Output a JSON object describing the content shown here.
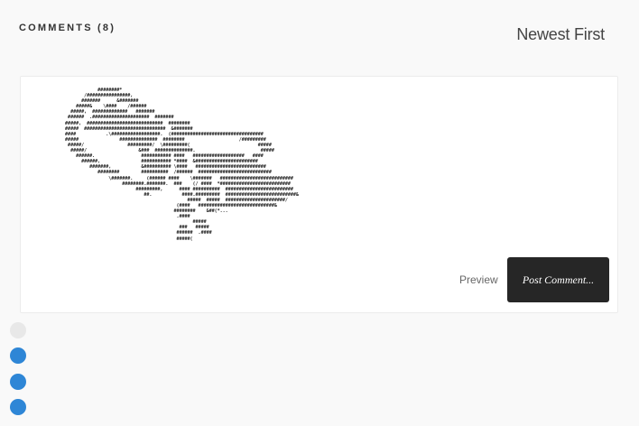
{
  "comments": {
    "heading": "COMMENTS (8)",
    "sort_label": "Newest First"
  },
  "editor": {
    "ascii_art": "                 ########*\n            /################,\n           #######      &#######\n         #####&    \\####    /######\n       #####,  #############   #######\n      ######  .#####################  #######\n     #####,  ############################  ########\n     #####  ##############################  &#######\n     ####           .\\##################.  (##################################\n     #####               ##############  ########                    /#########\n      #####/                #########/  \\#########(                         #####\n       #####/                   &###  ##############.                        #####\n         ######.                 ########### ####   ###################   ####\n           ######,               ########### *####  &#######################\n              #######,           &########## \\####   ##########################\n                 ########        ##########  /######  ###########################\n                     \\#######.     (###### ####    \\#######   ###########################\n                          ########.#######.  ###    (/ ####  *##########################\n                               #########,      #### ##########  #########################\n                                  ##.           ####.#########  ##########################&\n                                                  #####  #####  ######################/\n                                              (####   ############################&\n                                             ########    &##(*...\n                                              .####\n                                                    #####\n                                               ###   #####\n                                              ######  .####\n                                              #####("
  },
  "actions": {
    "preview_label": "Preview",
    "post_label": "Post Comment..."
  },
  "avatars": [
    {
      "color": "#e8e8e8"
    },
    {
      "color": "#2e86d6"
    },
    {
      "color": "#2e86d6"
    },
    {
      "color": "#2e86d6"
    }
  ]
}
